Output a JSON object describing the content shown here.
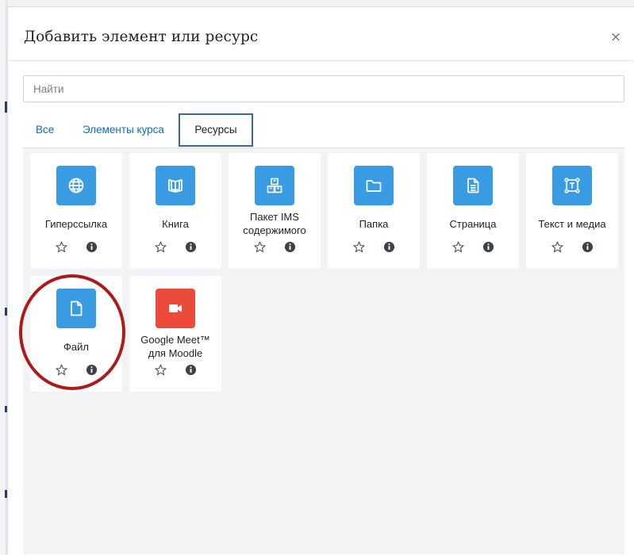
{
  "modal": {
    "title": "Добавить элемент или ресурс",
    "close_glyph": "×"
  },
  "search": {
    "placeholder": "Найти",
    "value": ""
  },
  "tabs": [
    {
      "label": "Все",
      "active": false
    },
    {
      "label": "Элементы курса",
      "active": false
    },
    {
      "label": "Ресурсы",
      "active": true
    }
  ],
  "resources": [
    {
      "label": "Гиперссылка",
      "icon": "globe-icon",
      "color": "#399be2"
    },
    {
      "label": "Книга",
      "icon": "book-icon",
      "color": "#399be2"
    },
    {
      "label": "Пакет IMS содержимого",
      "icon": "package-icon",
      "color": "#399be2"
    },
    {
      "label": "Папка",
      "icon": "folder-icon",
      "color": "#399be2"
    },
    {
      "label": "Страница",
      "icon": "page-icon",
      "color": "#399be2"
    },
    {
      "label": "Текст и медиа",
      "icon": "text-media-icon",
      "color": "#399be2"
    },
    {
      "label": "Файл",
      "icon": "file-icon",
      "color": "#399be2"
    },
    {
      "label": "Google Meet™ для Moodle",
      "icon": "video-camera-icon",
      "color": "#eb4b3a"
    }
  ],
  "card_actions": {
    "star_icon": "star-outline-icon",
    "info_icon": "info-icon"
  },
  "annotation": {
    "highlighted_item": "Файл",
    "color": "#b0191b"
  }
}
